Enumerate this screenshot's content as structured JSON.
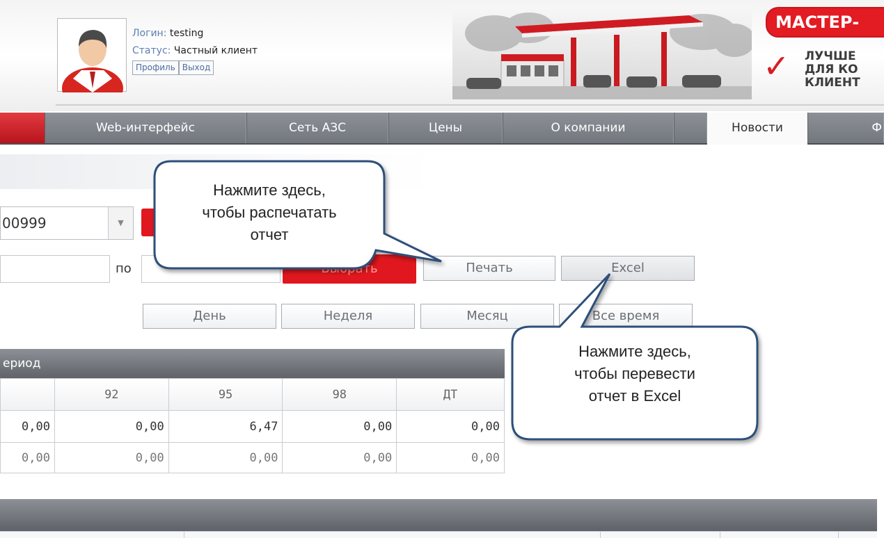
{
  "user": {
    "login_label": "Логин:",
    "login_value": "testing",
    "status_label": "Статус:",
    "status_value": "Частный клиент",
    "profile_button": "Профиль",
    "logout_button": "Выход"
  },
  "promo": {
    "banner": "МАСТЕР-",
    "text": "ЛУЧШЕ\nДЛЯ КО\nКЛИЕНТ"
  },
  "nav": {
    "items": [
      "Web-интерфейс",
      "Сеть АЗС",
      "Цены",
      "О компании",
      "Новости",
      "Ф"
    ],
    "active_index": 4
  },
  "filters": {
    "card_number": "00999",
    "date_separator": "по",
    "choose_button": "Выбрать",
    "print_button": "Печать",
    "excel_button": "Excel",
    "periods": [
      "День",
      "Неделя",
      "Месяц",
      "Все время"
    ]
  },
  "table": {
    "title": "ериод",
    "columns": [
      "",
      "92",
      "95",
      "98",
      "ДТ"
    ],
    "rows": [
      [
        "0,00",
        "0,00",
        "6,47",
        "0,00",
        "0,00"
      ],
      [
        "0,00",
        "0,00",
        "0,00",
        "0,00",
        "0,00"
      ]
    ]
  },
  "callouts": {
    "print": "Нажмите здесь,\nчтобы распечатать\nотчет",
    "excel": "Нажмите здесь,\nчтобы перевести\nотчет в Excel"
  },
  "colors": {
    "brand_red": "#e0171e",
    "nav_grey": "#7a7f86",
    "callout_border": "#2f4f7a"
  }
}
